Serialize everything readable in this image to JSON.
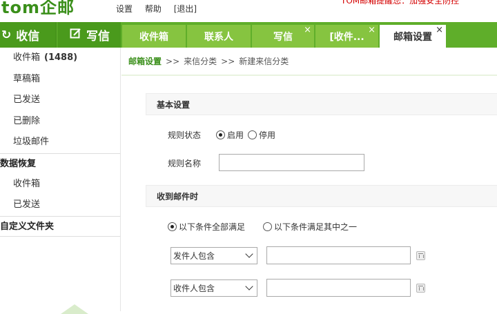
{
  "header": {
    "logo": "tom企邮",
    "links": [
      "设置",
      "帮助",
      "[退出]"
    ],
    "notice": "TOM邮箱提醒您：加强安全防控"
  },
  "nav": {
    "receive_label": "收信",
    "write_label": "写信",
    "tabs": [
      {
        "label": "收件箱",
        "closable": false,
        "active": false
      },
      {
        "label": "联系人",
        "closable": false,
        "active": false
      },
      {
        "label": "写信",
        "closable": true,
        "active": false
      },
      {
        "label": "[收件...",
        "closable": true,
        "active": false
      },
      {
        "label": "邮箱设置",
        "closable": true,
        "active": true
      }
    ],
    "close_glyph": "×"
  },
  "sidebar": {
    "inbox_label": "收件箱",
    "inbox_count": "(1488)",
    "folders": [
      "草稿箱",
      "已发送",
      "已删除",
      "垃圾邮件"
    ],
    "recovery_title": "数据恢复",
    "recovery_items": [
      "收件箱",
      "已发送"
    ],
    "custom_title": "自定义文件夹"
  },
  "breadcrumb": {
    "home": "邮箱设置",
    "sep": ">>",
    "items": [
      "来信分类",
      "新建来信分类"
    ]
  },
  "form": {
    "basic_title": "基本设置",
    "rule_status_label": "规则状态",
    "status_options": [
      "启用",
      "停用"
    ],
    "status_selected": "启用",
    "rule_name_label": "规则名称",
    "rule_name_value": "",
    "receive_title": "收到邮件时",
    "match_options": [
      "以下条件全部满足",
      "以下条件满足其中之一"
    ],
    "match_selected": "以下条件全部满足",
    "conditions": [
      {
        "field": "发件人包含",
        "value": ""
      },
      {
        "field": "收件人包含",
        "value": ""
      }
    ]
  },
  "colors": {
    "brand_green": "#5fae2a",
    "tab_green": "#86c440",
    "notice_red": "#d40000"
  }
}
